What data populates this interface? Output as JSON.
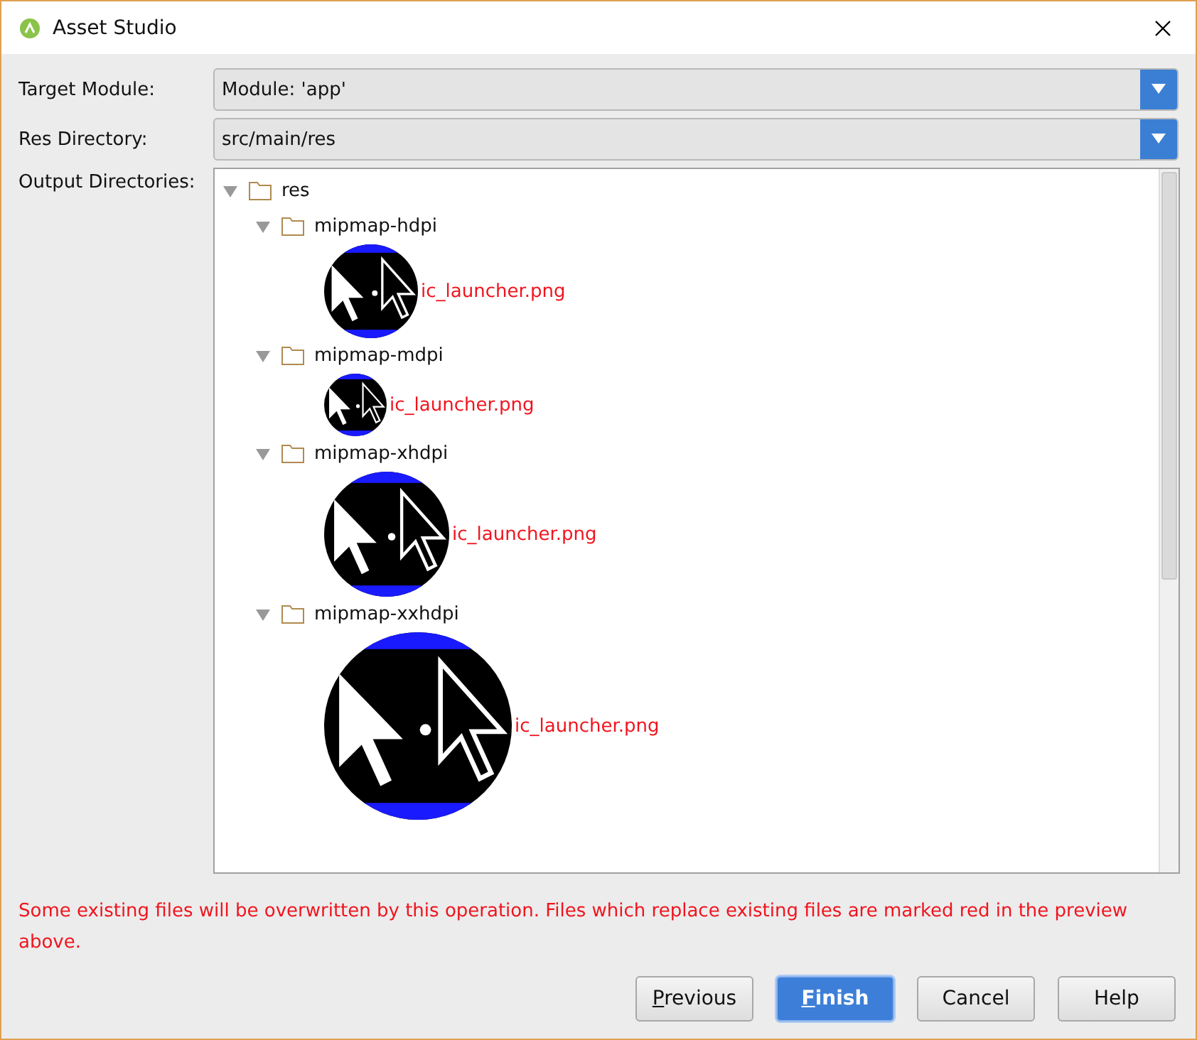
{
  "window": {
    "title": "Asset Studio"
  },
  "fields": [
    {
      "label": "Target Module:",
      "value": "Module: 'app'"
    },
    {
      "label": "Res Directory:",
      "value": "src/main/res"
    }
  ],
  "output": {
    "label": "Output Directories:",
    "tree": [
      {
        "name": "res",
        "expanded": true,
        "children": [
          {
            "name": "mipmap-hdpi",
            "expanded": true,
            "children": [
              {
                "name": "ic_launcher.png",
                "kind": "picture"
              }
            ]
          },
          {
            "name": "mipmap-mdpi",
            "expanded": true,
            "children": [
              {
                "name": "ic_launcher.png",
                "kind": "picture"
              }
            ]
          },
          {
            "name": "mipmap-xhdpi",
            "expanded": true,
            "children": [
              {
                "name": "ic_launcher.png",
                "kind": "picture"
              }
            ]
          },
          {
            "name": "mipmap-xxhdpi",
            "expanded": true,
            "children": [
              {
                "name": "ic_launcher.png",
                "kind": "picture"
              }
            ]
          }
        ]
      }
    ]
  },
  "warning": "Some existing files will be overwritten by this operation. Files which replace existing files are marked red in the preview above.",
  "buttons": [
    {
      "label": "Previous",
      "mnemonic": true,
      "default": false
    },
    {
      "label": "Finish",
      "mnemonic": true,
      "default": true
    },
    {
      "label": "Cancel",
      "mnemonic": false,
      "default": false
    },
    {
      "label": "Help",
      "mnemonic": false,
      "default": false
    }
  ]
}
